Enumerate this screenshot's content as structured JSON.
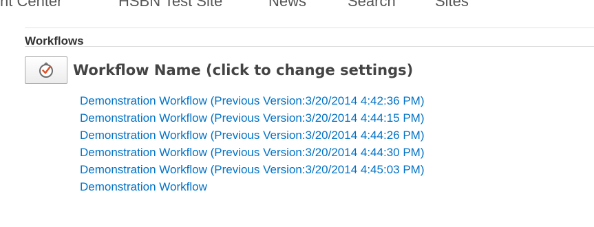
{
  "topnav": {
    "items": [
      "nt Center",
      "HSBN Test Site",
      "News",
      "Search",
      "Sites"
    ]
  },
  "workflows": {
    "section_title": "Workflows",
    "heading": "Workflow Name (click to change settings)",
    "items": [
      "Demonstration Workflow (Previous Version:3/20/2014 4:42:36 PM)",
      "Demonstration Workflow (Previous Version:3/20/2014 4:44:15 PM)",
      "Demonstration Workflow (Previous Version:3/20/2014 4:44:26 PM)",
      "Demonstration Workflow (Previous Version:3/20/2014 4:44:30 PM)",
      "Demonstration Workflow (Previous Version:3/20/2014 4:45:03 PM)",
      "Demonstration Workflow"
    ]
  },
  "icons": {
    "workflow_settings": "workflow-check-icon"
  },
  "colors": {
    "link": "#0072c6",
    "icon_accent": "#e0522a"
  }
}
